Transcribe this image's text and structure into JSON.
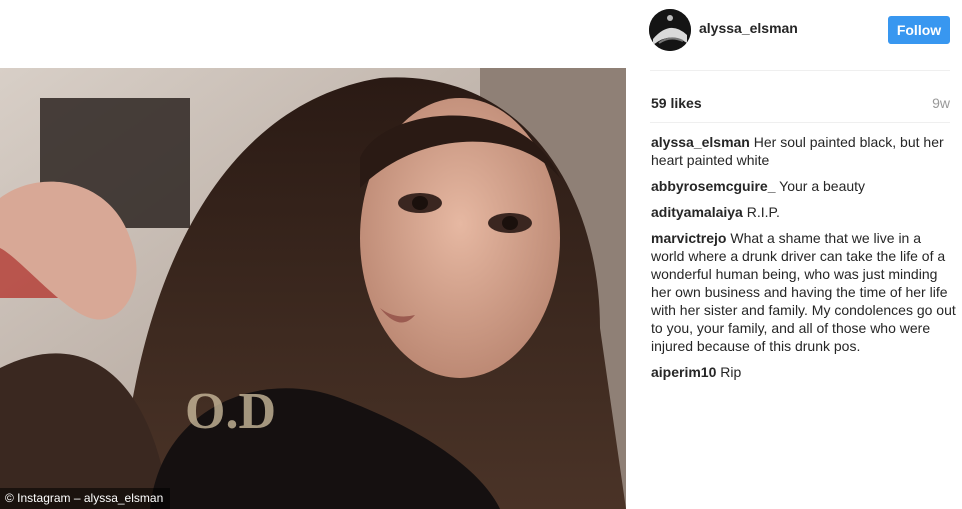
{
  "photo": {
    "credit": "© Instagram – alyssa_elsman",
    "shirt_print": "O.D"
  },
  "post": {
    "username": "alyssa_elsman",
    "follow_label": "Follow",
    "likes": "59 likes",
    "time": "9w",
    "comments": [
      {
        "author": "alyssa_elsman",
        "text": "Her soul painted black, but her heart painted white"
      },
      {
        "author": "abbyrosemcguire_",
        "text": "Your a beauty"
      },
      {
        "author": "adityamalaiya",
        "text": "R.I.P."
      },
      {
        "author": "marvictrejo",
        "text": "What a shame that we live in a world where a drunk driver can take the life of a wonderful human being, who was just minding her own business and having the time of her life with her sister and family. My condolences go out to you, your family, and all of those who were injured because of this drunk pos."
      },
      {
        "author": "aiperim10",
        "text": "Rip"
      }
    ]
  },
  "colors": {
    "follow_blue": "#3897f0",
    "text": "#262626",
    "muted": "#999999"
  }
}
